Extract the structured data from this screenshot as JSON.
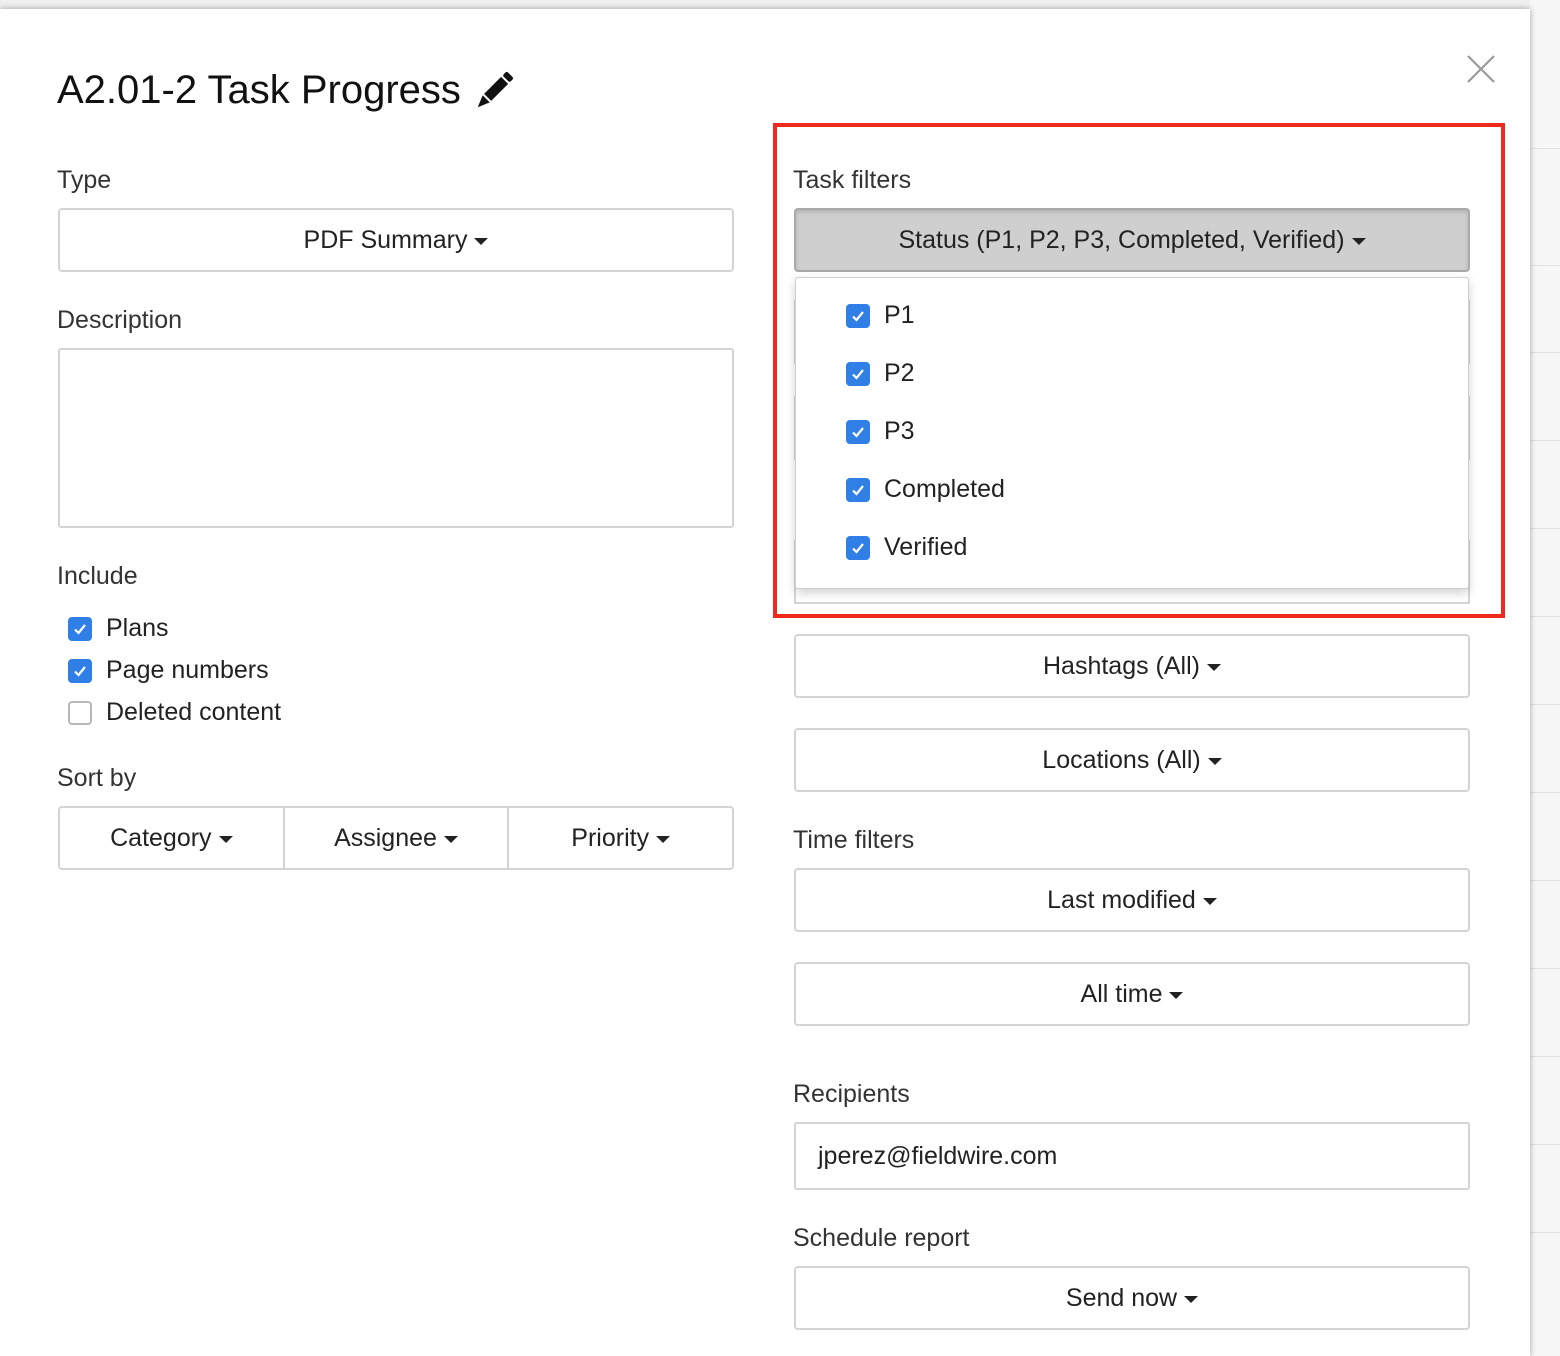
{
  "title": "A2.01-2 Task Progress",
  "type": {
    "label": "Type",
    "value": "PDF Summary"
  },
  "description": {
    "label": "Description",
    "value": ""
  },
  "include": {
    "label": "Include",
    "options": [
      {
        "label": "Plans",
        "checked": true
      },
      {
        "label": "Page numbers",
        "checked": true
      },
      {
        "label": "Deleted content",
        "checked": false
      }
    ]
  },
  "sort_by": {
    "label": "Sort by",
    "options": [
      "Category",
      "Assignee",
      "Priority"
    ]
  },
  "task_filters": {
    "label": "Task filters",
    "status_button": "Status (P1, P2, P3, Completed, Verified)",
    "status_options": [
      {
        "label": "P1",
        "checked": true
      },
      {
        "label": "P2",
        "checked": true
      },
      {
        "label": "P3",
        "checked": true
      },
      {
        "label": "Completed",
        "checked": true
      },
      {
        "label": "Verified",
        "checked": true
      }
    ],
    "hashtags_button": "Hashtags (All)",
    "locations_button": "Locations (All)"
  },
  "time_filters": {
    "label": "Time filters",
    "field_button": "Last modified",
    "range_button": "All time"
  },
  "recipients": {
    "label": "Recipients",
    "value": "jperez@fieldwire.com"
  },
  "schedule": {
    "label": "Schedule report",
    "value": "Send now"
  },
  "colors": {
    "checkbox_blue": "#2f7fe6",
    "highlight_red": "#f0291d"
  }
}
